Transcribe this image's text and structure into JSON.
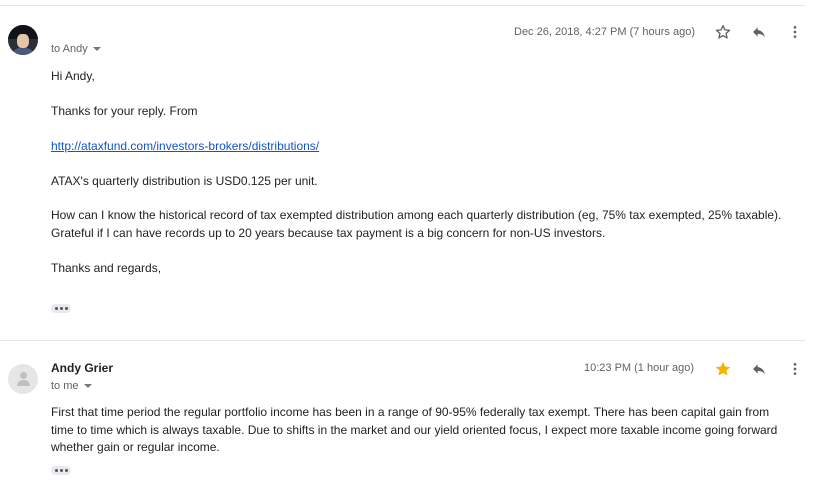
{
  "message1": {
    "recipient": "to Andy",
    "date": "Dec 26, 2018, 4:27 PM (7 hours ago)",
    "body": {
      "greeting": "Hi Andy,",
      "para1": "Thanks for your reply.  From",
      "link": "http://ataxfund.com/investors-brokers/distributions/",
      "para2": "ATAX's quarterly distribution is USD0.125 per unit.",
      "para3_line1": "How can I know the historical record of tax exempted distribution among each quarterly distribution (eg, 75% tax exempted, 25% taxable).",
      "para3_line2": "Grateful if I can have records up to 20 years because tax payment is a big concern for non-US investors.",
      "closing": "Thanks and regards,"
    },
    "starred": false,
    "icons": {
      "star": "star-outline-icon",
      "reply": "reply-icon",
      "more": "more-vert-icon"
    }
  },
  "message2": {
    "sender": "Andy Grier",
    "recipient": "to me",
    "date": "10:23 PM (1 hour ago)",
    "body": {
      "line1": "First that time period the regular portfolio income has been in a range of 90-95% federally tax exempt. There has been capital gain from",
      "line2": "time to time which is always taxable. Due to shifts in the market and our yield oriented focus, I expect more taxable income going forward",
      "line3": "whether gain or regular income."
    },
    "starred": true,
    "icons": {
      "star": "star-filled-icon",
      "reply": "reply-icon",
      "more": "more-vert-icon"
    }
  },
  "colors": {
    "link": "#1155cc",
    "star": "#f4b400",
    "meta": "#5f6368"
  }
}
